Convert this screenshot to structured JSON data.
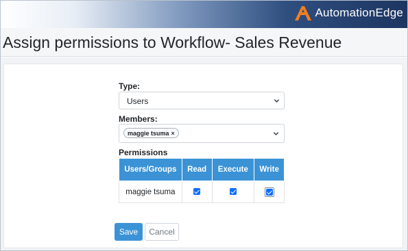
{
  "header": {
    "logo_text": "AutomationEdge",
    "logo_icon": "automationedge-logo-icon",
    "brand_color": "#f47c20"
  },
  "page": {
    "title": "Assign permissions to Workflow- Sales Revenue"
  },
  "form": {
    "type_label": "Type:",
    "type_value": "Users",
    "members_label": "Members:",
    "members": [
      {
        "name": "maggie tsuma",
        "remove": "×"
      }
    ],
    "permissions_label": "Permissions",
    "table": {
      "headers": [
        "Users/Groups",
        "Read",
        "Execute",
        "Write"
      ],
      "rows": [
        {
          "user": "maggie tsuma",
          "read": true,
          "execute": true,
          "write": true
        }
      ]
    },
    "save_label": "Save",
    "cancel_label": "Cancel"
  },
  "colors": {
    "primary": "#3b93d6",
    "checkbox": "#0d6efd"
  }
}
